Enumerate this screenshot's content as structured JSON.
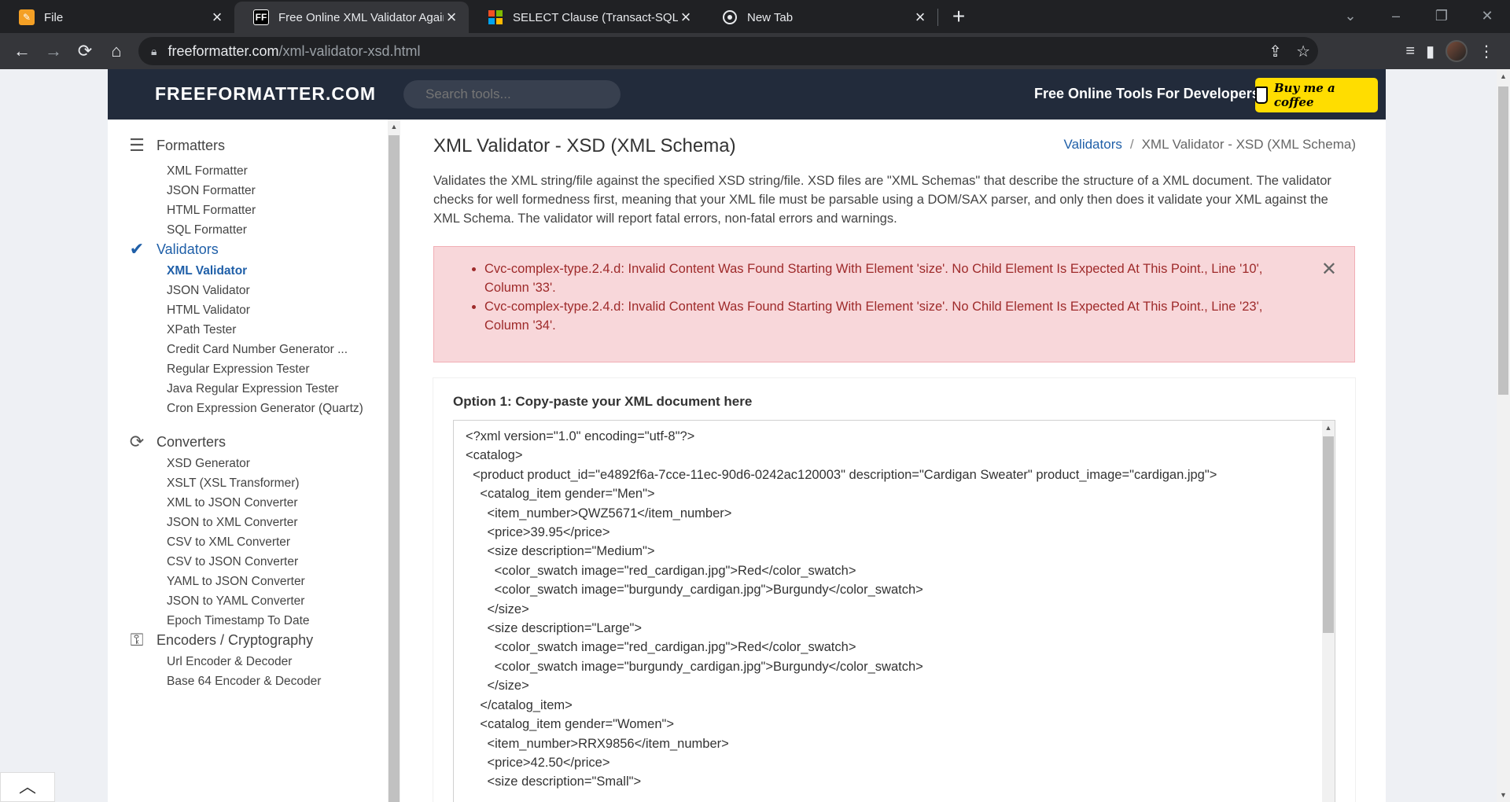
{
  "browser": {
    "tabs": [
      {
        "title": "File",
        "favicon": "pencil-icon",
        "favicon_color": "#f4a025",
        "active": false
      },
      {
        "title": "Free Online XML Validator Against XSD",
        "favicon": "FF",
        "favicon_color": "#ffffff",
        "active": true
      },
      {
        "title": "SELECT Clause (Transact-SQL) - SQL",
        "favicon": "microsoft-icon",
        "active": false
      },
      {
        "title": "New Tab",
        "favicon": "chrome-icon",
        "active": false
      }
    ],
    "url_host": "freeformatter.com",
    "url_path": "/xml-validator-xsd.html"
  },
  "header": {
    "logo": "FREEFORMATTER.COM",
    "search_placeholder": "Search tools...",
    "tagline": "Free Online Tools For Developers",
    "coffee_label": "Buy me a coffee",
    "bg_color": "#222b3b",
    "coffee_color": "#ffdd00"
  },
  "sidebar": {
    "sections": [
      {
        "label": "Formatters",
        "icon": "list-indent-icon",
        "items": [
          "XML Formatter",
          "JSON Formatter",
          "HTML Formatter",
          "SQL Formatter"
        ]
      },
      {
        "label": "Validators",
        "icon": "check-double-icon",
        "items": [
          "XML Validator",
          "JSON Validator",
          "HTML Validator",
          "XPath Tester",
          "Credit Card Number Generator ...",
          "Regular Expression Tester",
          "Java Regular Expression Tester",
          "Cron Expression Generator (Quartz)"
        ]
      },
      {
        "label": "Converters",
        "icon": "sync-icon",
        "items": [
          "XSD Generator",
          "XSLT (XSL Transformer)",
          "XML to JSON Converter",
          "JSON to XML Converter",
          "CSV to XML Converter",
          "CSV to JSON Converter",
          "YAML to JSON Converter",
          "JSON to YAML Converter",
          "Epoch Timestamp To Date"
        ]
      },
      {
        "label": "Encoders / Cryptography",
        "icon": "key-icon",
        "items": [
          "Url Encoder & Decoder",
          "Base 64 Encoder & Decoder"
        ]
      }
    ],
    "active_item": "XML Validator",
    "active_color": "#1f5fa8"
  },
  "main": {
    "title": "XML Validator - XSD (XML Schema)",
    "breadcrumb": {
      "parent": "Validators",
      "current": "XML Validator - XSD (XML Schema)"
    },
    "description": "Validates the XML string/file against the specified XSD string/file. XSD files are \"XML Schemas\" that describe the structure of a XML document. The validator checks for well formedness first, meaning that your XML file must be parsable using a DOM/SAX parser, and only then does it validate your XML against the XML Schema. The validator will report fatal errors, non-fatal errors and warnings.",
    "errors": [
      "Cvc-complex-type.2.4.d: Invalid Content Was Found Starting With Element 'size'. No Child Element Is Expected At This Point., Line '10', Column '33'.",
      "Cvc-complex-type.2.4.d: Invalid Content Was Found Starting With Element 'size'. No Child Element Is Expected At This Point., Line '23', Column '34'."
    ],
    "error_bg": "#f8d7da",
    "error_text_color": "#9e2a2a",
    "option1_label": "Option 1: Copy-paste your XML document here",
    "xml_content": "<?xml version=\"1.0\" encoding=\"utf-8\"?>\n<catalog>\n  <product product_id=\"e4892f6a-7cce-11ec-90d6-0242ac120003\" description=\"Cardigan Sweater\" product_image=\"cardigan.jpg\">\n    <catalog_item gender=\"Men\">\n      <item_number>QWZ5671</item_number>\n      <price>39.95</price>\n      <size description=\"Medium\">\n        <color_swatch image=\"red_cardigan.jpg\">Red</color_swatch>\n        <color_swatch image=\"burgundy_cardigan.jpg\">Burgundy</color_swatch>\n      </size>\n      <size description=\"Large\">\n        <color_swatch image=\"red_cardigan.jpg\">Red</color_swatch>\n        <color_swatch image=\"burgundy_cardigan.jpg\">Burgundy</color_swatch>\n      </size>\n    </catalog_item>\n    <catalog_item gender=\"Women\">\n      <item_number>RRX9856</item_number>\n      <price>42.50</price>\n      <size description=\"Small\">"
  }
}
